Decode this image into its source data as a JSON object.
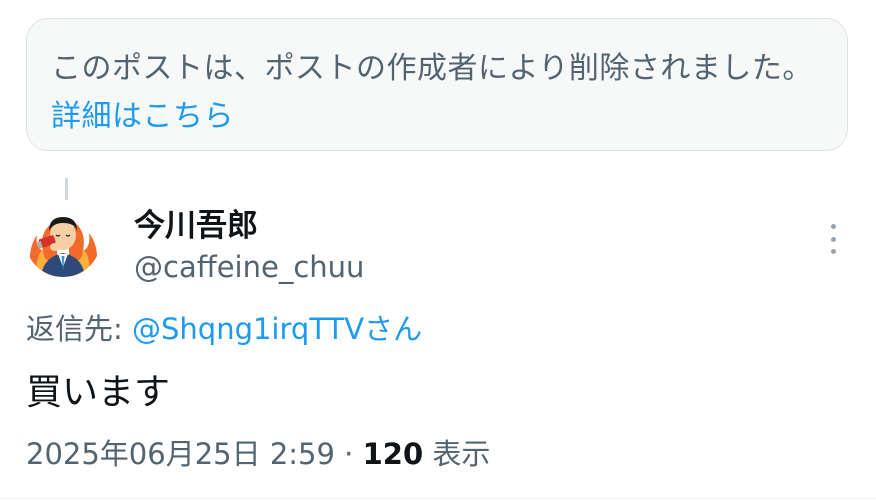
{
  "deleted_notice": {
    "text": "このポストは、ポストの作成者により削除されました。",
    "link": "詳細はこちら"
  },
  "tweet": {
    "display_name": "今川吾郎",
    "handle": "@caffeine_chuu",
    "reply_prefix": "返信先: ",
    "reply_mention": "@Shqng1irqTTVさん",
    "text": "買います",
    "date": "2025年06月25日 2:59",
    "separator": "·",
    "view_count": "120",
    "view_label": "表示"
  },
  "icons": {
    "avatar": "avatar-businessman-burning-icon",
    "more": "more-vertical-icon"
  },
  "colors": {
    "link": "#1d9bf0",
    "secondary_text": "#536471",
    "primary_text": "#0f1419",
    "box_bg": "#f7f9f9"
  }
}
